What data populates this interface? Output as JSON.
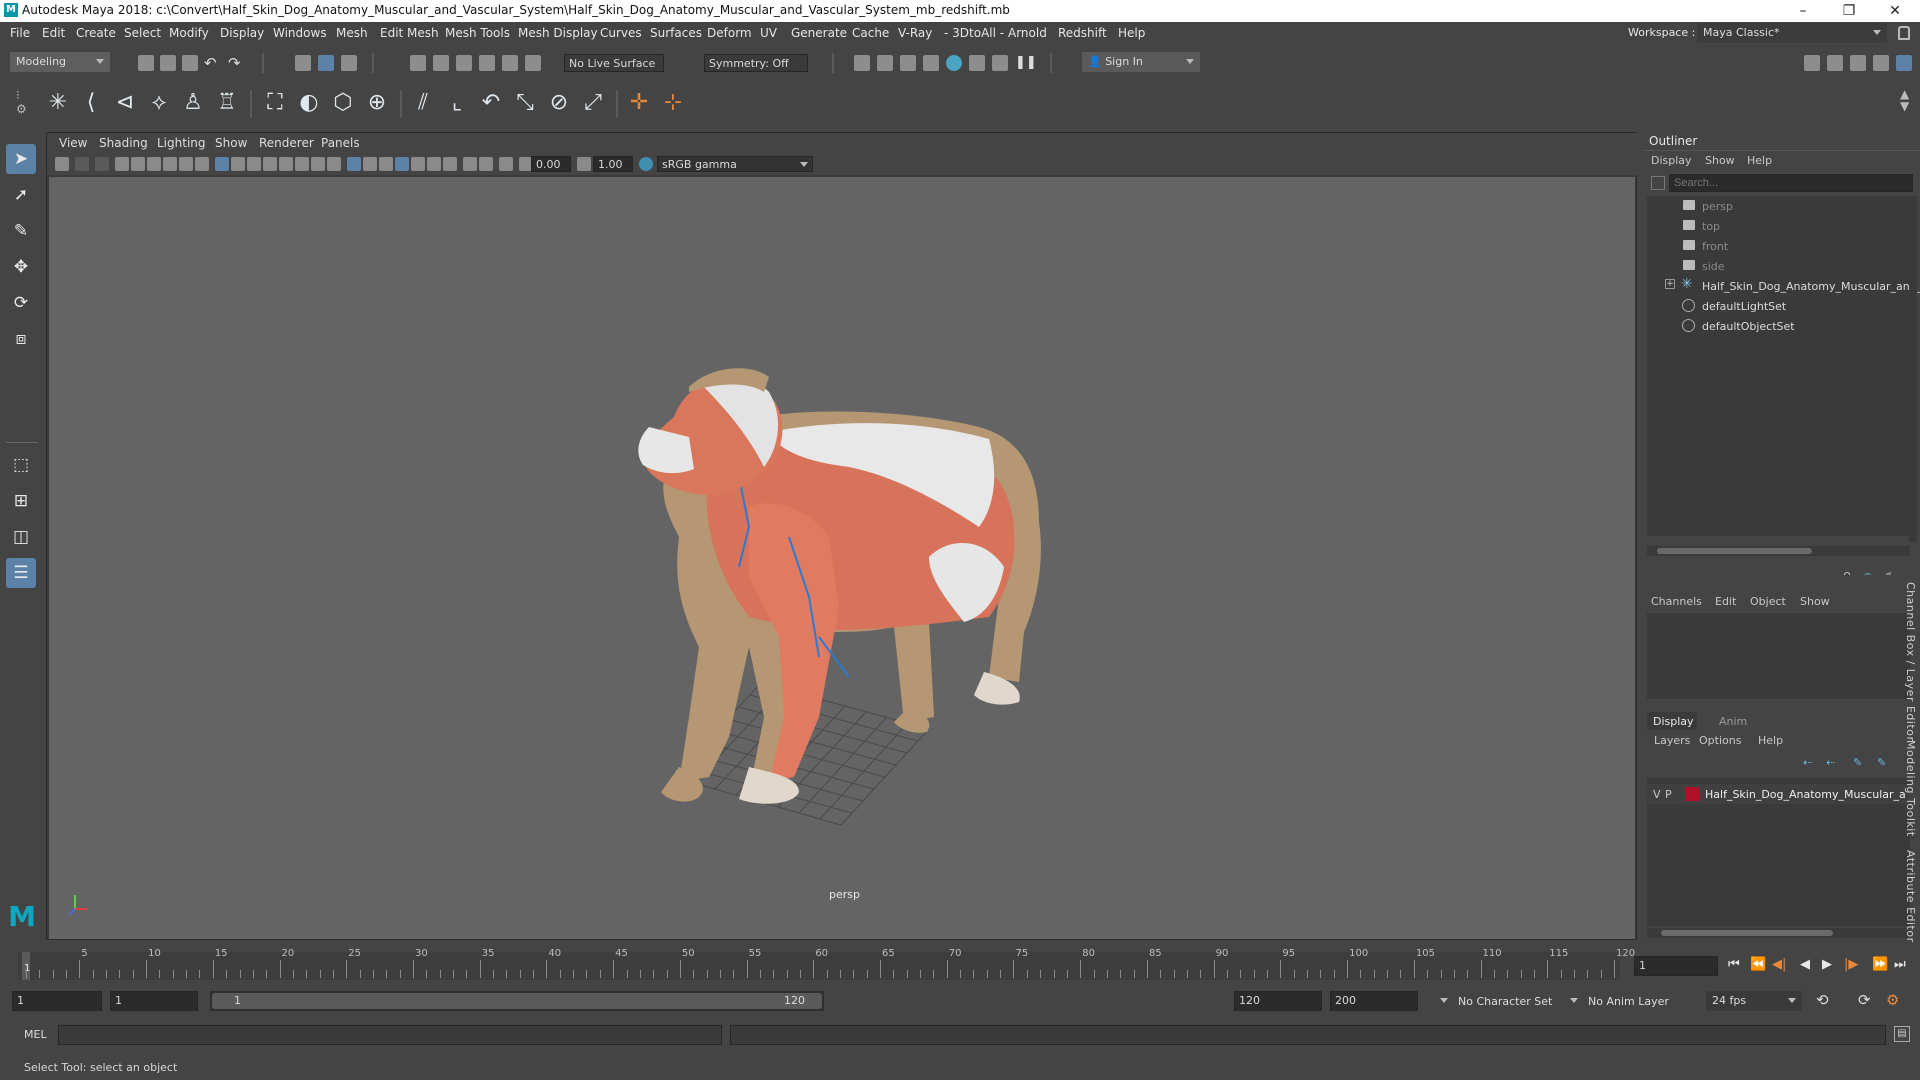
{
  "app": {
    "title": "Autodesk Maya 2018: c:\\Convert\\Half_Skin_Dog_Anatomy_Muscular_and_Vascular_System\\Half_Skin_Dog_Anatomy_Muscular_and_Vascular_System_mb_redshift.mb",
    "logo": "M",
    "window_controls": [
      "–",
      "❐",
      "✕"
    ]
  },
  "menubar": {
    "items": [
      "File",
      "Edit",
      "Create",
      "Select",
      "Modify",
      "Display",
      "Windows",
      "Mesh",
      "Edit Mesh",
      "Mesh Tools",
      "Mesh Display",
      "Curves",
      "Surfaces",
      "Deform",
      "UV",
      "Generate",
      "Cache",
      "V-Ray",
      "- 3DtoAll -",
      "Arnold",
      "Redshift",
      "Help"
    ],
    "workspace_label": "Workspace :",
    "workspace_value": "Maya Classic*"
  },
  "statusline": {
    "mode": "Modeling",
    "live_surface": "No Live Surface",
    "symmetry": "Symmetry: Off",
    "sign_in": "Sign In"
  },
  "viewport": {
    "menu": [
      "View",
      "Shading",
      "Lighting",
      "Show",
      "Renderer",
      "Panels"
    ],
    "exposure": "0.00",
    "gamma": "1.00",
    "colorspace": "sRGB gamma",
    "camera_label": "persp"
  },
  "outliner": {
    "title": "Outliner",
    "menu": [
      "Display",
      "Show",
      "Help"
    ],
    "search_placeholder": "Search...",
    "items": [
      {
        "label": "persp",
        "icon": "camera-icon",
        "dim": true
      },
      {
        "label": "top",
        "icon": "camera-icon",
        "dim": true
      },
      {
        "label": "front",
        "icon": "camera-icon",
        "dim": true
      },
      {
        "label": "side",
        "icon": "camera-icon",
        "dim": true
      },
      {
        "label": "Half_Skin_Dog_Anatomy_Muscular_and_",
        "icon": "group-icon",
        "dim": false
      },
      {
        "label": "defaultLightSet",
        "icon": "set-icon",
        "dim": false
      },
      {
        "label": "defaultObjectSet",
        "icon": "set-icon",
        "dim": false
      }
    ]
  },
  "channelbox": {
    "menu": [
      "Channels",
      "Edit",
      "Object",
      "Show"
    ]
  },
  "layers": {
    "tabs": [
      "Display",
      "Anim"
    ],
    "menu": [
      "Layers",
      "Options",
      "Help"
    ],
    "layer": {
      "v": "V",
      "p": "P",
      "name": "Half_Skin_Dog_Anatomy_Muscular_a",
      "color": "#b0102a"
    }
  },
  "side_tabs": [
    "Channel Box / Layer Editor",
    "Modeling Toolkit",
    "Attribute Editor"
  ],
  "timeslider": {
    "ticks": [
      "5",
      "10",
      "15",
      "20",
      "25",
      "30",
      "35",
      "40",
      "45",
      "50",
      "55",
      "60",
      "65",
      "70",
      "75",
      "80",
      "85",
      "90",
      "95",
      "100",
      "105",
      "110",
      "115",
      "120"
    ],
    "start_marker": "1",
    "current_frame": "1"
  },
  "range": {
    "start": "1",
    "playback_start": "1",
    "slider_start": "1",
    "slider_end": "120",
    "playback_end": "120",
    "end": "200",
    "character_set": "No Character Set",
    "anim_layer": "No Anim Layer",
    "fps": "24 fps"
  },
  "cmdline": {
    "lang": "MEL"
  },
  "helpline": {
    "text": "Select Tool: select an object"
  }
}
